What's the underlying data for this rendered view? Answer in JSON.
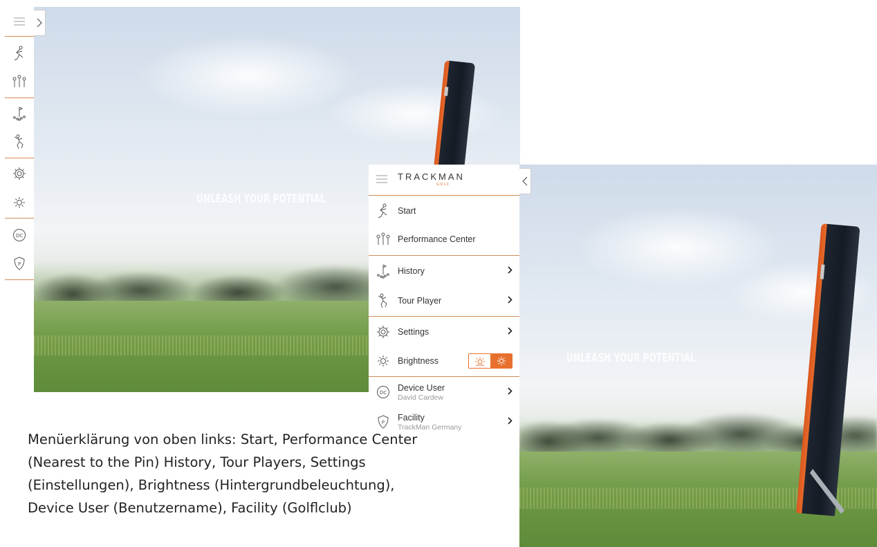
{
  "left_screen": {
    "tagline": "UNLEASH YOUR POTENTIAL"
  },
  "right_screen": {
    "tagline": "UNLEASH YOUR POTENTIAL"
  },
  "collapsed_sidebar": {
    "icons": [
      "menu-icon",
      "golfer-swing-icon",
      "pins-icon",
      "shots-dispersion-icon",
      "tour-player-icon",
      "gear-icon",
      "sun-icon",
      "device-user-icon",
      "facility-icon"
    ]
  },
  "menu": {
    "logo": "TRACKMAN",
    "logo_sub": "GOLF",
    "items": [
      {
        "label": "Start",
        "icon": "golfer-swing-icon"
      },
      {
        "label": "Performance Center",
        "icon": "pins-icon"
      },
      {
        "label": "History",
        "icon": "shots-dispersion-icon"
      },
      {
        "label": "Tour Player",
        "icon": "tour-player-icon"
      },
      {
        "label": "Settings",
        "icon": "gear-icon"
      },
      {
        "label": "Brightness",
        "icon": "sun-icon"
      },
      {
        "label": "Device User",
        "sub": "David Cardew",
        "icon": "device-user-icon"
      },
      {
        "label": "Facility",
        "sub": "TrackMan Germany",
        "icon": "facility-icon"
      }
    ],
    "brightness_toggle": {
      "selected": "bright"
    },
    "accent": "#e8702e"
  },
  "caption": {
    "line1": "Menüerklärung von oben links: Start, Performance Center",
    "line2": "(Nearest to the Pin) History, Tour Players, Settings",
    "line3": "(Einstellungen), Brightness (Hintergrundbeleuchtung),",
    "line4": "Device User (Benutzername), Facility (Golflclub)"
  }
}
